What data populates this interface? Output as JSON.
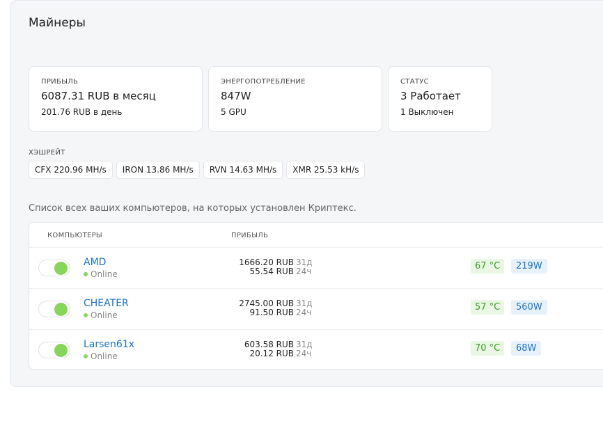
{
  "page": {
    "title": "Майнеры"
  },
  "stats": {
    "profit": {
      "label": "ПРИБЫЛЬ",
      "value": "6087.31 RUB в месяц",
      "sub": "201.76 RUB в день"
    },
    "power": {
      "label": "ЭНЕРГОПОТРЕБЛЕНИЕ",
      "value": "847W",
      "sub": "5 GPU"
    },
    "status": {
      "label": "СТАТУС",
      "value": "3 Работает",
      "sub": "1 Выключен"
    }
  },
  "hashrate": {
    "title": "ХЭШРЕЙТ",
    "items": [
      "CFX 220.96 MH/s",
      "IRON 13.86 MH/s",
      "RVN 14.63 MH/s",
      "XMR 25.53 kH/s"
    ]
  },
  "list": {
    "description": "Список всех ваших компьютеров, на которых установлен Криптекс.",
    "columns": {
      "computers": "КОМПЬЮТЕРЫ",
      "profit": "ПРИБЫЛЬ"
    },
    "rows": [
      {
        "name": "AMD",
        "status": "Online",
        "profit_month": "1666.20 RUB",
        "profit_month_unit": "31д",
        "profit_day": "55.54 RUB",
        "profit_day_unit": "24ч",
        "temp": "67 °C",
        "power": "219W",
        "enabled": true
      },
      {
        "name": "CHEATER",
        "status": "Online",
        "profit_month": "2745.00 RUB",
        "profit_month_unit": "31д",
        "profit_day": "91.50 RUB",
        "profit_day_unit": "24ч",
        "temp": "57 °C",
        "power": "560W",
        "enabled": true
      },
      {
        "name": "Larsen61x",
        "status": "Online",
        "profit_month": "603.58 RUB",
        "profit_month_unit": "31д",
        "profit_day": "20.12 RUB",
        "profit_day_unit": "24ч",
        "temp": "70 °C",
        "power": "68W",
        "enabled": true
      }
    ]
  },
  "colors": {
    "accent": "#1a73c8",
    "online": "#86d65a",
    "temp_text": "#3a9d23"
  }
}
